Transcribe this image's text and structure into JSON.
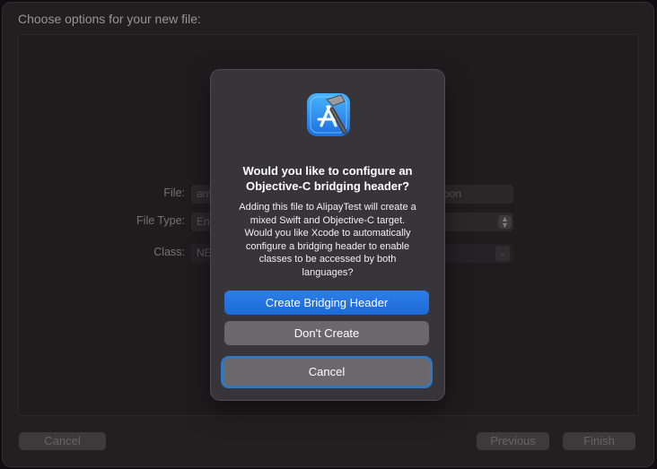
{
  "window": {
    "top_hint": "Choose options for your new file:"
  },
  "header": {
    "title": "Choose options for your new file:"
  },
  "form": {
    "file_label": "File:",
    "file_value": "any",
    "file_tail": "soon",
    "file_type_label": "File Type:",
    "file_type_value": "En",
    "class_label": "Class:",
    "class_value": "NE"
  },
  "footer": {
    "cancel_label": "Cancel",
    "previous_label": "Previous",
    "finish_label": "Finish"
  },
  "dialog": {
    "icon": "xcode-app-icon",
    "title": "Would you like to configure an\nObjective-C bridging header?",
    "message": "Adding this file to AlipayTest will create a\nmixed Swift and Objective-C target.\nWould you like Xcode to automatically\nconfigure a bridging header to enable\nclasses to be accessed by both\nlanguages?",
    "create_label": "Create Bridging Header",
    "dont_create_label": "Don't Create",
    "cancel_label": "Cancel"
  },
  "colors": {
    "primary_button": "#1f70dd",
    "focus_ring": "#2f78c4",
    "sheet_background": "#38353a"
  }
}
